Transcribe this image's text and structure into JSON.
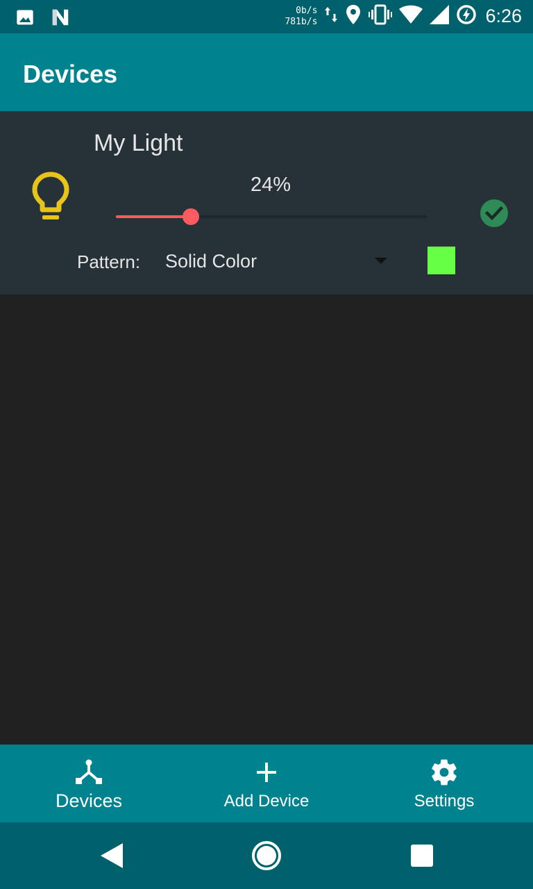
{
  "status_bar": {
    "net_up": "0b/s",
    "net_down": "781b/s",
    "time": "6:26",
    "left_icons": [
      "image-icon",
      "notification-n-icon"
    ],
    "right_icons": [
      "data-arrows-icon",
      "location-icon",
      "vibrate-icon",
      "wifi-icon",
      "signal-icon",
      "battery-saver-icon"
    ]
  },
  "app_bar": {
    "title": "Devices"
  },
  "device": {
    "name": "My Light",
    "icon": "lightbulb-icon",
    "brightness_label": "24%",
    "brightness_fraction": 0.24,
    "status_icon": "check-circle-icon",
    "pattern_label": "Pattern:",
    "pattern_value": "Solid Color",
    "swatch_color": "#66ff44"
  },
  "bottom_nav": {
    "items": [
      {
        "label": "Devices",
        "icon": "devices-hub-icon",
        "active": true
      },
      {
        "label": "Add Device",
        "icon": "plus-icon",
        "active": false
      },
      {
        "label": "Settings",
        "icon": "gear-icon",
        "active": false
      }
    ]
  },
  "system_nav": {
    "buttons": [
      "back-icon",
      "home-icon",
      "recents-icon"
    ]
  },
  "colors": {
    "status_bar": "#00606b",
    "app_bar": "#00838f",
    "card": "#263238",
    "background": "#212121",
    "accent": "#ff5a5f",
    "bulb": "#e8c41b",
    "check": "#2e8b57"
  }
}
